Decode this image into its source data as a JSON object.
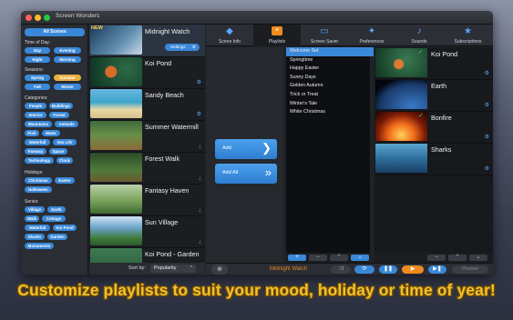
{
  "window": {
    "title": "Screen Wonders"
  },
  "sidebar": {
    "all_scenes": "All Scenes",
    "groups": [
      {
        "title": "Time of Day:",
        "items": [
          "Day",
          "Evening",
          "Night",
          "Morning"
        ]
      },
      {
        "title": "Seasons:",
        "items": [
          "Spring",
          "Summer",
          "Fall",
          "Winter"
        ],
        "selected": "Summer"
      },
      {
        "title": "Categories:",
        "items": [
          "People",
          "Buildings",
          "Interior",
          "Forest",
          "Mountains",
          "Animals",
          "Fish",
          "Water",
          "Waterfall",
          "Sea Life",
          "Fantasy",
          "Space",
          "Technology",
          "Clock"
        ]
      },
      {
        "title": "Holidays:",
        "items": [
          "Christmas",
          "Easter",
          "Halloween"
        ]
      },
      {
        "title": "Series:",
        "items": [
          "Village",
          "Earth",
          "Walk",
          "Cottage",
          "Waterfall",
          "Koi Pond",
          "Sharks",
          "Garden",
          "Monuments"
        ]
      }
    ]
  },
  "scenes": {
    "items": [
      {
        "name": "Midnight Watch",
        "badge": "NEW",
        "action": "Settings",
        "status": "settings"
      },
      {
        "name": "Koi Pond",
        "status": "settings"
      },
      {
        "name": "Sandy Beach",
        "status": "settings"
      },
      {
        "name": "Summer Watermill",
        "status": "download"
      },
      {
        "name": "Forest Walk",
        "status": "download"
      },
      {
        "name": "Fantasy Haven",
        "status": "download"
      },
      {
        "name": "Sun Village",
        "status": "download"
      },
      {
        "name": "Koi Pond - Garden",
        "status": "none"
      }
    ],
    "sort_label": "Sort by:",
    "sort_value": "Popularity"
  },
  "tabs": [
    {
      "label": "Scene Info",
      "icon": "scene-info-icon"
    },
    {
      "label": "Playlists",
      "icon": "playlists-icon",
      "active": true
    },
    {
      "label": "Screen Saver",
      "icon": "screen-saver-icon"
    },
    {
      "label": "Preferences",
      "icon": "preferences-icon"
    },
    {
      "label": "Sounds",
      "icon": "sounds-icon"
    },
    {
      "label": "Subscriptions",
      "icon": "subscriptions-icon"
    }
  ],
  "actions": {
    "add": "Add",
    "add_all": "Add All"
  },
  "playlists": {
    "items": [
      "Welcome Set",
      "Springtime",
      "Happy Easter",
      "Sunny Days",
      "Golden Autumn",
      "Trick or Treat",
      "Winter's Tale",
      "White Christmas"
    ],
    "selected": "Welcome Set"
  },
  "playlist_scenes": [
    "Koi Pond",
    "Earth",
    "Bonfire",
    "Sharks"
  ],
  "player": {
    "now_playing": "Midnight Watch",
    "preview": "Preview"
  },
  "caption": "Customize playlists to suit your mood, holiday or time of year!",
  "colors": {
    "accent": "#3a88d8",
    "selected_pill": "#e8b040",
    "caption": "#f4c030",
    "check": "#3cd070"
  }
}
